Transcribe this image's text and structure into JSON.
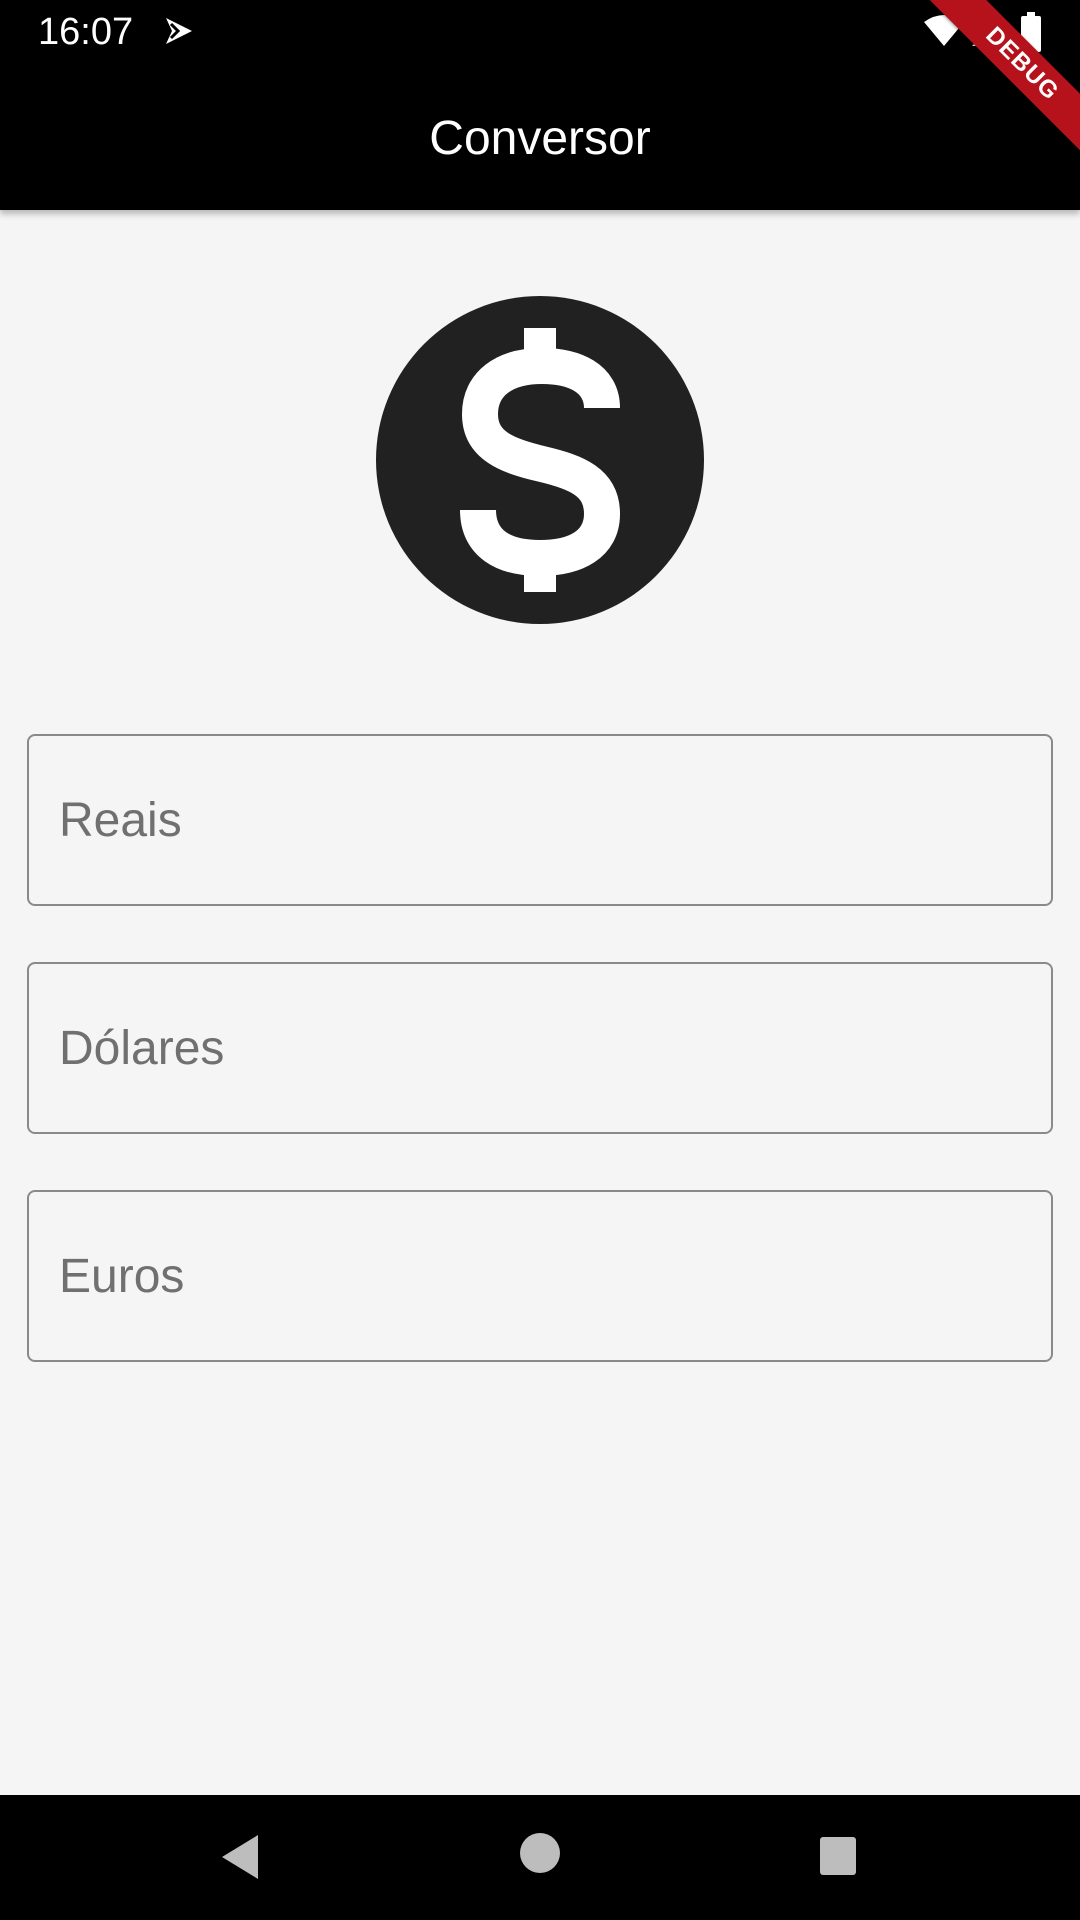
{
  "status_bar": {
    "time": "16:07",
    "icons": [
      "notification-icon",
      "wifi-icon",
      "signal-icon",
      "battery-icon"
    ]
  },
  "app_bar": {
    "title": "Conversor",
    "debug_banner": "DEBUG",
    "background": "#000000"
  },
  "main": {
    "icon": "dollar-circle-icon",
    "fields": {
      "reais": {
        "value": "",
        "placeholder": "Reais"
      },
      "dolares": {
        "value": "",
        "placeholder": "Dólares"
      },
      "euros": {
        "value": "",
        "placeholder": "Euros"
      }
    }
  },
  "nav_bar": {
    "buttons": [
      "back-icon",
      "home-icon",
      "recents-icon"
    ]
  }
}
